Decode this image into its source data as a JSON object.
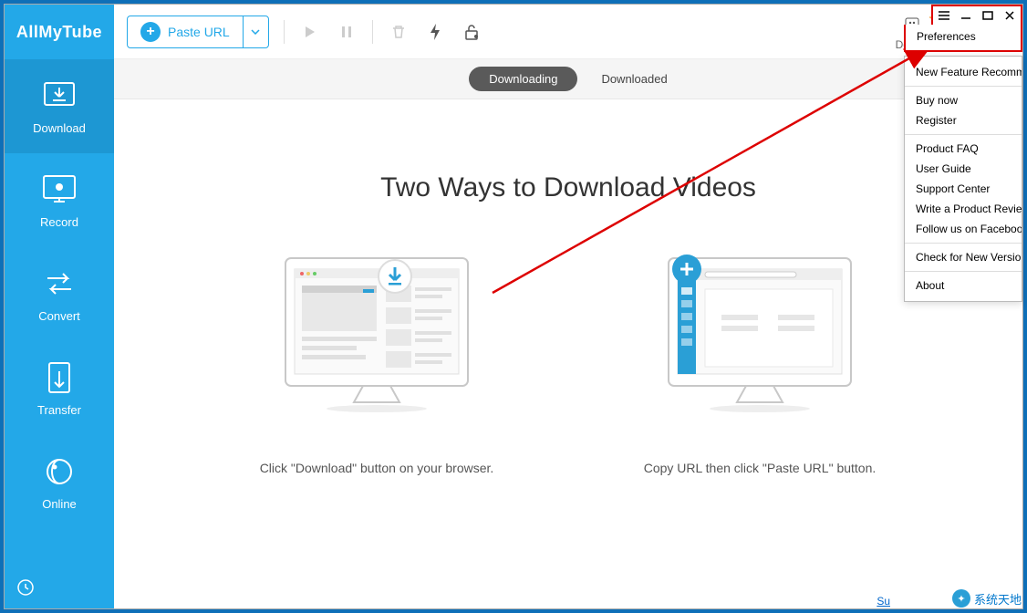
{
  "brand": "AllMyTube",
  "sidebar": {
    "items": [
      {
        "label": "Download"
      },
      {
        "label": "Record"
      },
      {
        "label": "Convert"
      },
      {
        "label": "Transfer"
      },
      {
        "label": "Online"
      }
    ]
  },
  "toolbar": {
    "paste_label": "Paste URL",
    "register_label": "Register",
    "hint": "Download then Convert"
  },
  "tabs": {
    "downloading": "Downloading",
    "downloaded": "Downloaded"
  },
  "main": {
    "headline": "Two Ways to Download Videos",
    "way1": "Click \"Download\" button on your browser.",
    "way2": "Copy URL then click \"Paste URL\" button."
  },
  "menu": {
    "preferences": "Preferences",
    "items_top": [
      "New Feature Recommend"
    ],
    "items_mid": [
      "Buy now",
      "Register"
    ],
    "items_help": [
      "Product FAQ",
      "User Guide",
      "Support Center",
      "Write a Product Review",
      "Follow us on Facebook"
    ],
    "items_bottom": [
      "Check for New Version"
    ],
    "items_last": [
      "About"
    ]
  },
  "watermark": "系统天地",
  "su": "Su"
}
